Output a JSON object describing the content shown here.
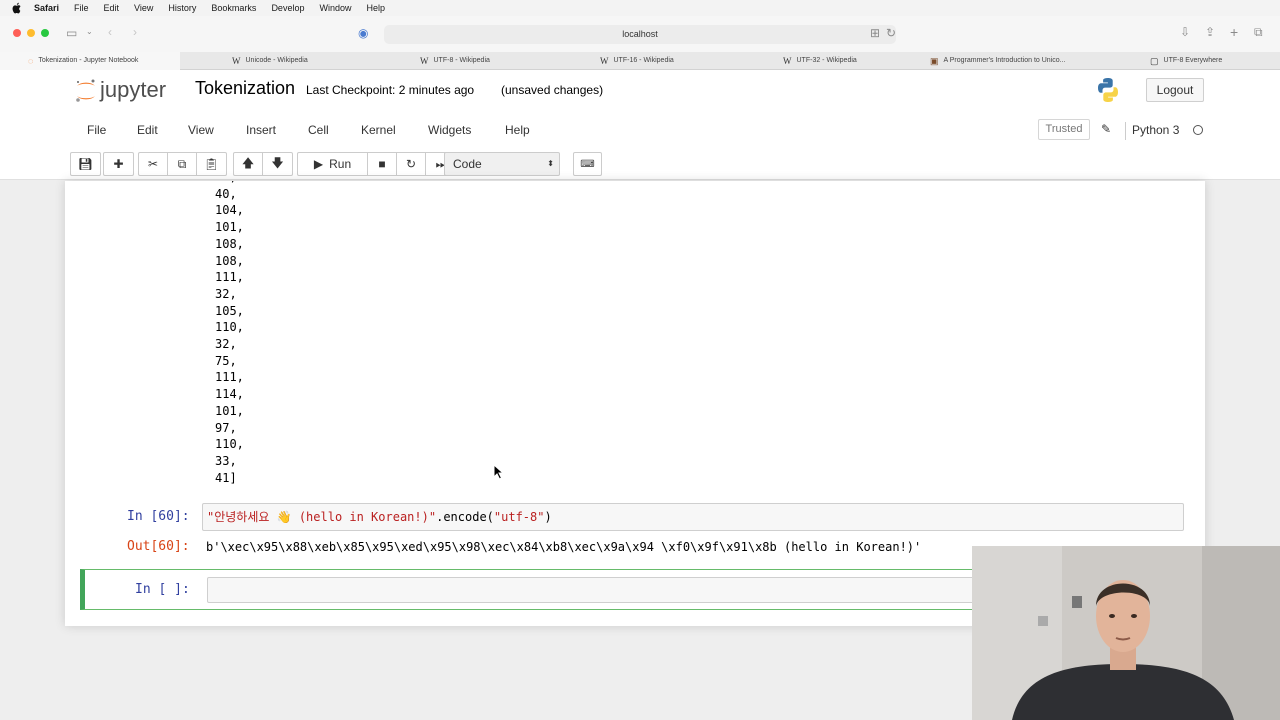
{
  "macos_menu": [
    "Safari",
    "File",
    "Edit",
    "View",
    "History",
    "Bookmarks",
    "Develop",
    "Window",
    "Help"
  ],
  "address_bar": "localhost",
  "tabs": [
    {
      "title": "Tokenization - Jupyter Notebook",
      "icon": "jupyter-favicon"
    },
    {
      "title": "Unicode - Wikipedia",
      "icon": "wikipedia-favicon"
    },
    {
      "title": "UTF-8 - Wikipedia",
      "icon": "wikipedia-favicon"
    },
    {
      "title": "UTF-16 - Wikipedia",
      "icon": "wikipedia-favicon"
    },
    {
      "title": "UTF-32 - Wikipedia",
      "icon": "wikipedia-favicon"
    },
    {
      "title": "A Programmer's Introduction to Unico...",
      "icon": "site-favicon"
    },
    {
      "title": "UTF-8 Everywhere",
      "icon": "site-favicon"
    }
  ],
  "jupyter": {
    "logo_text": "jupyter",
    "notebook_title": "Tokenization",
    "checkpoint": "Last Checkpoint: 2 minutes ago",
    "unsaved": "(unsaved changes)",
    "logout": "Logout",
    "menu": [
      "File",
      "Edit",
      "View",
      "Insert",
      "Cell",
      "Kernel",
      "Widgets",
      "Help"
    ],
    "trusted": "Trusted",
    "kernel_name": "Python 3",
    "run_label": "Run",
    "cell_type": "Code"
  },
  "output_list": [
    "40,",
    "104,",
    "101,",
    "108,",
    "108,",
    "111,",
    "32,",
    "105,",
    "110,",
    "32,",
    "75,",
    "111,",
    "114,",
    "101,",
    "97,",
    "110,",
    "33,",
    "41]"
  ],
  "cell60": {
    "in_prompt": "In [60]:",
    "string_literal": "\"안녕하세요 👋 (hello in Korean!)\"",
    "method_call": ".encode(",
    "arg": "\"utf-8\"",
    "close": ")",
    "out_prompt": "Out[60]:",
    "output": "b'\\xec\\x95\\x88\\xeb\\x85\\x95\\xed\\x95\\x98\\xec\\x84\\xb8\\xec\\x9a\\x94 \\xf0\\x9f\\x91\\x8b (hello in Korean!)'"
  },
  "empty_cell": {
    "in_prompt": "In [ ]:"
  },
  "colors": {
    "in_prompt": "#303f9f",
    "out_prompt": "#d84315",
    "active_cell_border": "#42a55a",
    "jupyter_orange": "#f37726"
  }
}
